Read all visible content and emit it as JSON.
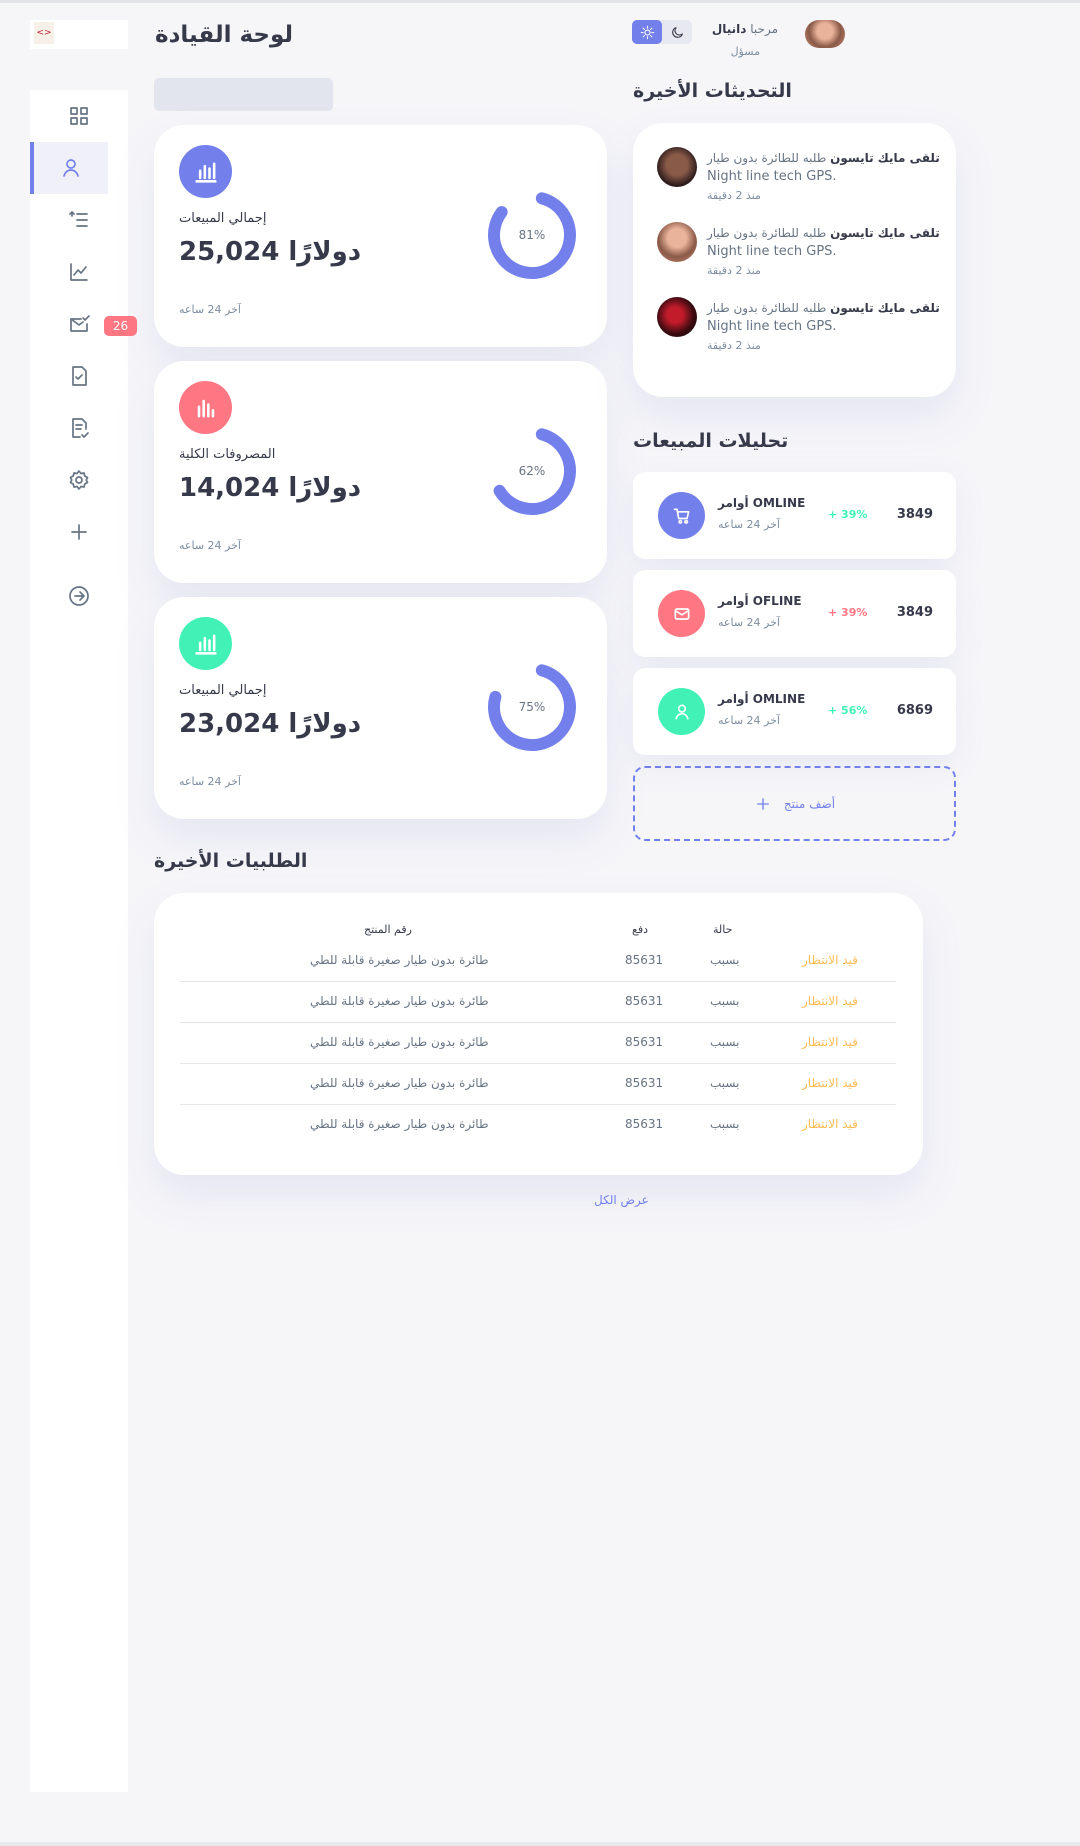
{
  "header": {
    "page_title": "لوحة القيادة",
    "greeting": "مرحبا",
    "user_name": "دانيال",
    "user_role": "مسؤل"
  },
  "logo": {
    "mark_text": "<>"
  },
  "sidebar": {
    "items": [
      {
        "name": "dashboard",
        "icon": "grid-icon"
      },
      {
        "name": "customers",
        "icon": "user-icon"
      },
      {
        "name": "orders",
        "icon": "list-icon"
      },
      {
        "name": "analytics",
        "icon": "chart-line-icon"
      },
      {
        "name": "messages",
        "icon": "mail-check-icon"
      },
      {
        "name": "products",
        "icon": "document-check-icon"
      },
      {
        "name": "reports",
        "icon": "report-icon"
      },
      {
        "name": "settings",
        "icon": "gear-icon"
      },
      {
        "name": "add-product",
        "icon": "plus-icon"
      },
      {
        "name": "logout",
        "icon": "logout-icon"
      }
    ],
    "messages_badge": "26"
  },
  "cards": [
    {
      "label": "إجمالي المبيعات",
      "amount": "دولارًا 25,024",
      "note": "آخر 24 ساعه",
      "percent": 81,
      "percent_label": "81%",
      "color": "#7380ec"
    },
    {
      "label": "المصروفات الكلية",
      "amount": "دولارًا 14,024",
      "note": "آخر 24 ساعه",
      "percent": 62,
      "percent_label": "62%",
      "color": "#ff7782"
    },
    {
      "label": "إجمالي المبيعات",
      "amount": "دولارًا 23,024",
      "note": "آخر 24 ساعه",
      "percent": 75,
      "percent_label": "75%",
      "color": "#41f1b6"
    }
  ],
  "updates": {
    "title": "التحديثات الأخيرة",
    "items": [
      {
        "name": "تلقى مايك تايسون",
        "text": "طلبه للطائرة بدون طيار",
        "detail": "Night line tech GPS.",
        "time": "منذ 2 دقيقة"
      },
      {
        "name": "تلقى مايك تايسون",
        "text": "طلبه للطائرة بدون طيار",
        "detail": "Night line tech GPS.",
        "time": "منذ 2 دقيقة"
      },
      {
        "name": "تلقى مايك تايسون",
        "text": "طلبه للطائرة بدون طيار",
        "detail": "Night line tech GPS.",
        "time": "منذ 2 دقيقة"
      }
    ]
  },
  "sales_analytics": {
    "title": "تحليلات المبيعات",
    "items": [
      {
        "title": "أوامر OMLINE",
        "note": "آخر 24 ساعه",
        "percent": "+ 39%",
        "value": "3849",
        "color": "#7380ec",
        "percent_color": "#41f1b6",
        "icon": "cart-icon"
      },
      {
        "title": "أوامر OFLINE",
        "note": "آخر 24 ساعه",
        "percent": "+ 39%",
        "value": "3849",
        "color": "#ff7782",
        "percent_color": "#ff7782",
        "icon": "mail-icon"
      },
      {
        "title": "أوامر OMLINE",
        "note": "آخر 24 ساعه",
        "percent": "+ 56%",
        "value": "6869",
        "color": "#41f1b6",
        "percent_color": "#41f1b6",
        "icon": "user-icon"
      }
    ],
    "add_product_label": "أضف منتج"
  },
  "orders": {
    "title": "الطلبيات الأخيرة",
    "columns": {
      "product": "رقم المنتج",
      "payment": "دفع",
      "status": "حالة"
    },
    "rows": [
      {
        "product": "طائرة بدون طيار صغيرة قابلة للطي",
        "number": "85631",
        "payment": "بسبب",
        "status": "قيد الانتظار"
      },
      {
        "product": "طائرة بدون طيار صغيرة قابلة للطي",
        "number": "85631",
        "payment": "بسبب",
        "status": "قيد الانتظار"
      },
      {
        "product": "طائرة بدون طيار صغيرة قابلة للطي",
        "number": "85631",
        "payment": "بسبب",
        "status": "قيد الانتظار"
      },
      {
        "product": "طائرة بدون طيار صغيرة قابلة للطي",
        "number": "85631",
        "payment": "بسبب",
        "status": "قيد الانتظار"
      },
      {
        "product": "طائرة بدون طيار صغيرة قابلة للطي",
        "number": "85631",
        "payment": "بسبب",
        "status": "قيد الانتظار"
      }
    ],
    "view_all": "عرض الكل",
    "status_color": "#ffbb55"
  },
  "colors": {
    "primary": "#7380ec",
    "danger": "#ff7782",
    "success": "#41f1b6",
    "warning": "#ffbb55"
  }
}
